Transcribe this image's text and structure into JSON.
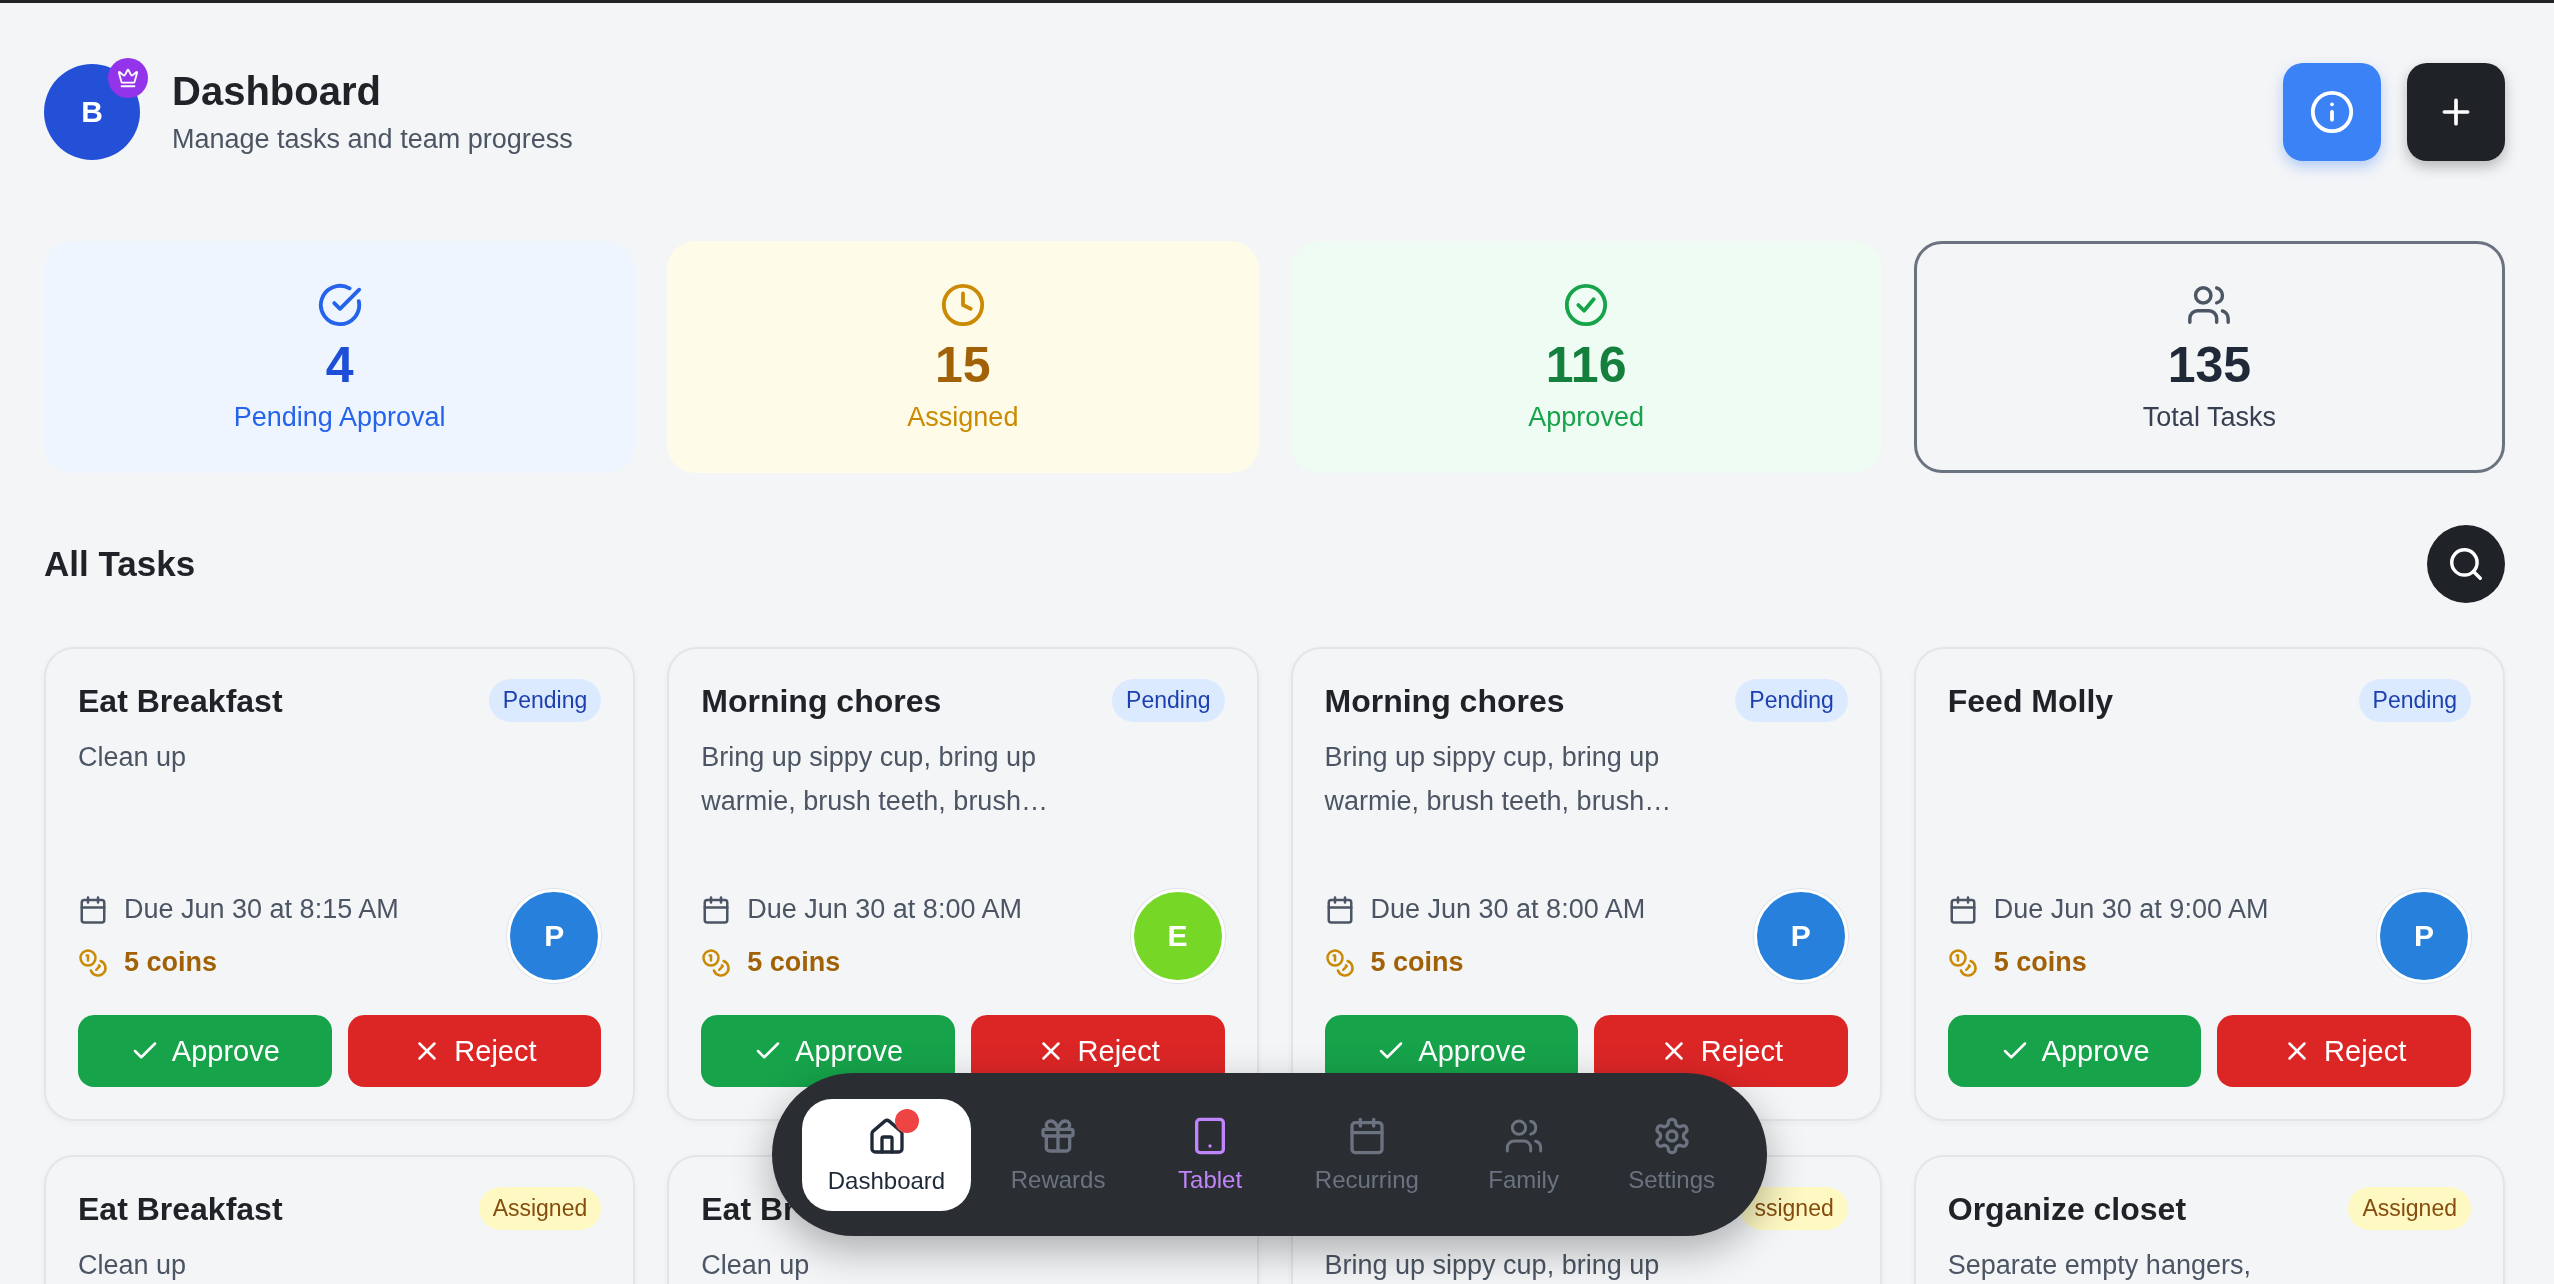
{
  "header": {
    "avatar_initial": "B",
    "premium": true,
    "title": "Dashboard",
    "subtitle": "Manage tasks and team progress"
  },
  "stats": [
    {
      "kind": "pending",
      "value": "4",
      "label": "Pending Approval",
      "selected": false
    },
    {
      "kind": "assigned",
      "value": "15",
      "label": "Assigned",
      "selected": false
    },
    {
      "kind": "approved",
      "value": "116",
      "label": "Approved",
      "selected": false
    },
    {
      "kind": "total",
      "value": "135",
      "label": "Total Tasks",
      "selected": true
    }
  ],
  "section_title": "All Tasks",
  "tasks": [
    {
      "title": "Eat Breakfast",
      "kind": "pending",
      "badge": "Pending",
      "description": "Clean up",
      "due": "Due Jun 30 at 8:15 AM",
      "coins": "5 coins",
      "assignee": {
        "initial": "P",
        "color": "#2680dc"
      },
      "actions": [
        "Approve",
        "Reject"
      ]
    },
    {
      "title": "Morning chores",
      "kind": "pending",
      "badge": "Pending",
      "description": "Bring up sippy cup, bring up warmie, brush teeth, brush…",
      "due": "Due Jun 30 at 8:00 AM",
      "coins": "5 coins",
      "assignee": {
        "initial": "E",
        "color": "#76d727"
      },
      "actions": [
        "Approve",
        "Reject"
      ]
    },
    {
      "title": "Morning chores",
      "kind": "pending",
      "badge": "Pending",
      "description": "Bring up sippy cup, bring up warmie, brush teeth, brush…",
      "due": "Due Jun 30 at 8:00 AM",
      "coins": "5 coins",
      "assignee": {
        "initial": "P",
        "color": "#2680dc"
      },
      "actions": [
        "Approve",
        "Reject"
      ]
    },
    {
      "title": "Feed Molly",
      "kind": "pending",
      "badge": "Pending",
      "due": "Due Jun 30 at 9:00 AM",
      "coins": "5 coins",
      "assignee": {
        "initial": "P",
        "color": "#2680dc"
      },
      "actions": [
        "Approve",
        "Reject"
      ]
    },
    {
      "title": "Eat Breakfast",
      "kind": "assigned",
      "badge": "Assigned",
      "description": "Clean up"
    },
    {
      "title": "Eat Br",
      "description": "Clean up"
    },
    {
      "kind": "assigned",
      "badge": "ssigned",
      "description": "Bring up sippy cup, bring up"
    },
    {
      "title": "Organize closet",
      "kind": "assigned",
      "badge": "Assigned",
      "description": "Separate empty hangers,"
    }
  ],
  "nav": [
    {
      "kind": "home",
      "label": "Dashboard",
      "selected": true,
      "highlighted": false,
      "notification": true
    },
    {
      "kind": "gift",
      "label": "Rewards",
      "selected": false,
      "highlighted": false,
      "notification": false
    },
    {
      "kind": "tablet",
      "label": "Tablet",
      "selected": false,
      "highlighted": true,
      "notification": false
    },
    {
      "kind": "calendar",
      "label": "Recurring",
      "selected": false,
      "highlighted": false,
      "notification": false
    },
    {
      "kind": "users",
      "label": "Family",
      "selected": false,
      "highlighted": false,
      "notification": false
    },
    {
      "kind": "gear",
      "label": "Settings",
      "selected": false,
      "highlighted": false,
      "notification": false
    }
  ]
}
